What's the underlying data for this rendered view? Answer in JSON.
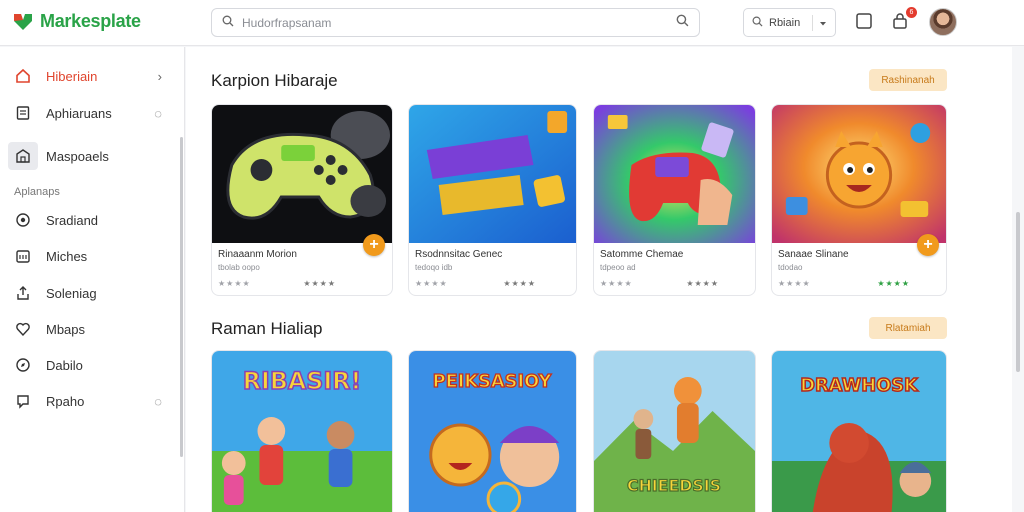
{
  "app": {
    "title": "Markesplate"
  },
  "search": {
    "placeholder": "Hudorfrapsanam"
  },
  "filter": {
    "label": "Rbiain"
  },
  "notifications": {
    "count": "6"
  },
  "sidebar": {
    "items": [
      {
        "label": "Hiberiain",
        "icon": "home-icon",
        "active": true,
        "tail": "›"
      },
      {
        "label": "Aphiaruans",
        "icon": "document-icon",
        "tail": "◌"
      },
      {
        "label": "Maspoaels",
        "icon": "marketplace-icon",
        "selected": true
      }
    ],
    "section_label": "Aplanaps",
    "section_items": [
      {
        "label": "Sradiand",
        "icon": "record-icon"
      },
      {
        "label": "Miches",
        "icon": "calendar-icon"
      },
      {
        "label": "Soleniag",
        "icon": "upload-icon"
      },
      {
        "label": "Mbaps",
        "icon": "heart-icon"
      },
      {
        "label": "Dabilo",
        "icon": "compass-icon"
      },
      {
        "label": "Rpaho",
        "icon": "reply-icon",
        "tail": "◌"
      }
    ]
  },
  "sections": [
    {
      "title": "Karpion Hibaraje",
      "button": "Rashinanah",
      "cards": [
        {
          "title": "Rinaaanm Morion",
          "sub": "tbolab oopo",
          "rating": "★★★★",
          "rating2": "★★★★",
          "plus": true
        },
        {
          "title": "Rsodnnsitac Genec",
          "sub": "tedoqo idb",
          "rating": "★★★★",
          "rating2": "★★★★"
        },
        {
          "title": "Satomme Chemae",
          "sub": "tdpeoo ad",
          "rating": "★★★★",
          "rating2": "★★★★"
        },
        {
          "title": "Sanaae Slinane",
          "sub": "tdodao",
          "rating": "★★★★",
          "rating2": "★★★★",
          "rating2_green": true,
          "plus": true
        }
      ]
    },
    {
      "title": "Raman Hialiap",
      "button": "Rlatamiah",
      "cards": [
        {
          "art": "RIBASIR!"
        },
        {
          "art": "PEIKSASIOY"
        },
        {
          "art": "CHIEEDSIS"
        },
        {
          "art": "DRAWHOSK"
        }
      ]
    }
  ],
  "colors": {
    "brand": "#2aa348",
    "accent": "#f19a1c",
    "active": "#e0452e"
  }
}
